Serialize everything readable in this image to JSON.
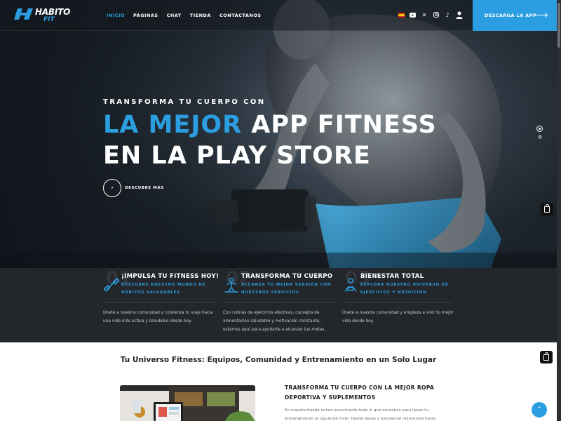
{
  "brand": {
    "name_primary": "HABITO",
    "name_secondary": "FIT",
    "accent": "#2a9ee0",
    "dark_bg": "#23272c"
  },
  "nav": [
    {
      "label": "INICIO",
      "active": true
    },
    {
      "label": "PÁGINAS",
      "active": false
    },
    {
      "label": "CHAT",
      "active": false
    },
    {
      "label": "TIENDA",
      "active": false
    },
    {
      "label": "CONTÁCTANOS",
      "active": false
    }
  ],
  "header_icons": [
    "spain-flag-icon",
    "youtube-icon",
    "x-icon",
    "instagram-icon",
    "tiktok-icon",
    "user-icon"
  ],
  "cta": {
    "label": "DESCARGA LA APP"
  },
  "hero": {
    "eyebrow": "TRANSFORMA TU CUERPO CON",
    "headline_accent": "LA MEJOR",
    "headline_rest_1": "APP FITNESS",
    "headline_line_2": "EN LA PLAY STORE",
    "discover_label": "DESCUBRE MÁS"
  },
  "features": [
    {
      "num": "01",
      "icon": "dumbbell-icon",
      "title": "¡IMPULSA TU FITNESS HOY!",
      "subtitle": "DESCUBRE NUESTRO MUNDO DE HÁBITOS SALUDABLES",
      "body": "Únete a nuestra comunidad y comienza tu viaje hacia una vida más activa y saludable desde hoy."
    },
    {
      "num": "02",
      "icon": "workout-icon",
      "title": "TRANSFORMA TU CUERPO",
      "subtitle": "ALCANZA TU MEJOR VERSIÓN CON NUESTROS SERVICIOS",
      "body": "Con rutinas de ejercicios efectivas, consejos de alimentación saludable y motivación constante, estamos aquí para ayudarte a alcanzar tus metas."
    },
    {
      "num": "03",
      "icon": "trainer-icon",
      "title": "BIENESTAR TOTAL",
      "subtitle": "EXPLORA NUESTRO UNIVERSO DE EJERCICIOS Y NUTRICIÓN",
      "body": "Únete a nuestra comunidad y empieza a vivir tu mejor vida desde hoy."
    }
  ],
  "section": {
    "title": "Tu Universo Fitness: Equipos, Comunidad y Entrenamiento en un Solo Lugar"
  },
  "promo": {
    "title": "TRANSFORMA TU CUERPO CON LA MEJOR ROPA DEPORTIVA Y SUPLEMENTOS",
    "body": "En nuestra tienda online encontrarás todo lo que necesitas para llevar tu entrenamiento al siguiente nivel. Desde pesas y bandas de resistencia hasta"
  }
}
